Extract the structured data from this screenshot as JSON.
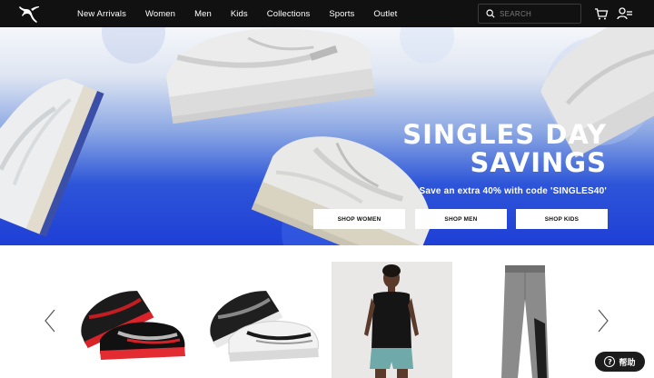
{
  "header": {
    "nav": [
      "New Arrivals",
      "Women",
      "Men",
      "Kids",
      "Collections",
      "Sports",
      "Outlet"
    ],
    "search_placeholder": "SEARCH"
  },
  "hero": {
    "title_line1": "SINGLES DAY",
    "title_line2": "SAVINGS",
    "subtitle": "Save an extra 40% with code 'SINGLES40'",
    "buttons": [
      "SHOP WOMEN",
      "SHOP MEN",
      "SHOP KIDS"
    ]
  },
  "help_label": "帮助",
  "icons": {
    "logo": "puma-cat-logo",
    "search": "search-icon",
    "cart": "cart-icon",
    "account": "account-icon",
    "prev": "chevron-left-icon",
    "next": "chevron-right-icon",
    "help": "question-icon"
  },
  "colors": {
    "header_bg": "#111111",
    "hero_blue": "#2146d9",
    "help_bg": "#1c1c1c"
  }
}
